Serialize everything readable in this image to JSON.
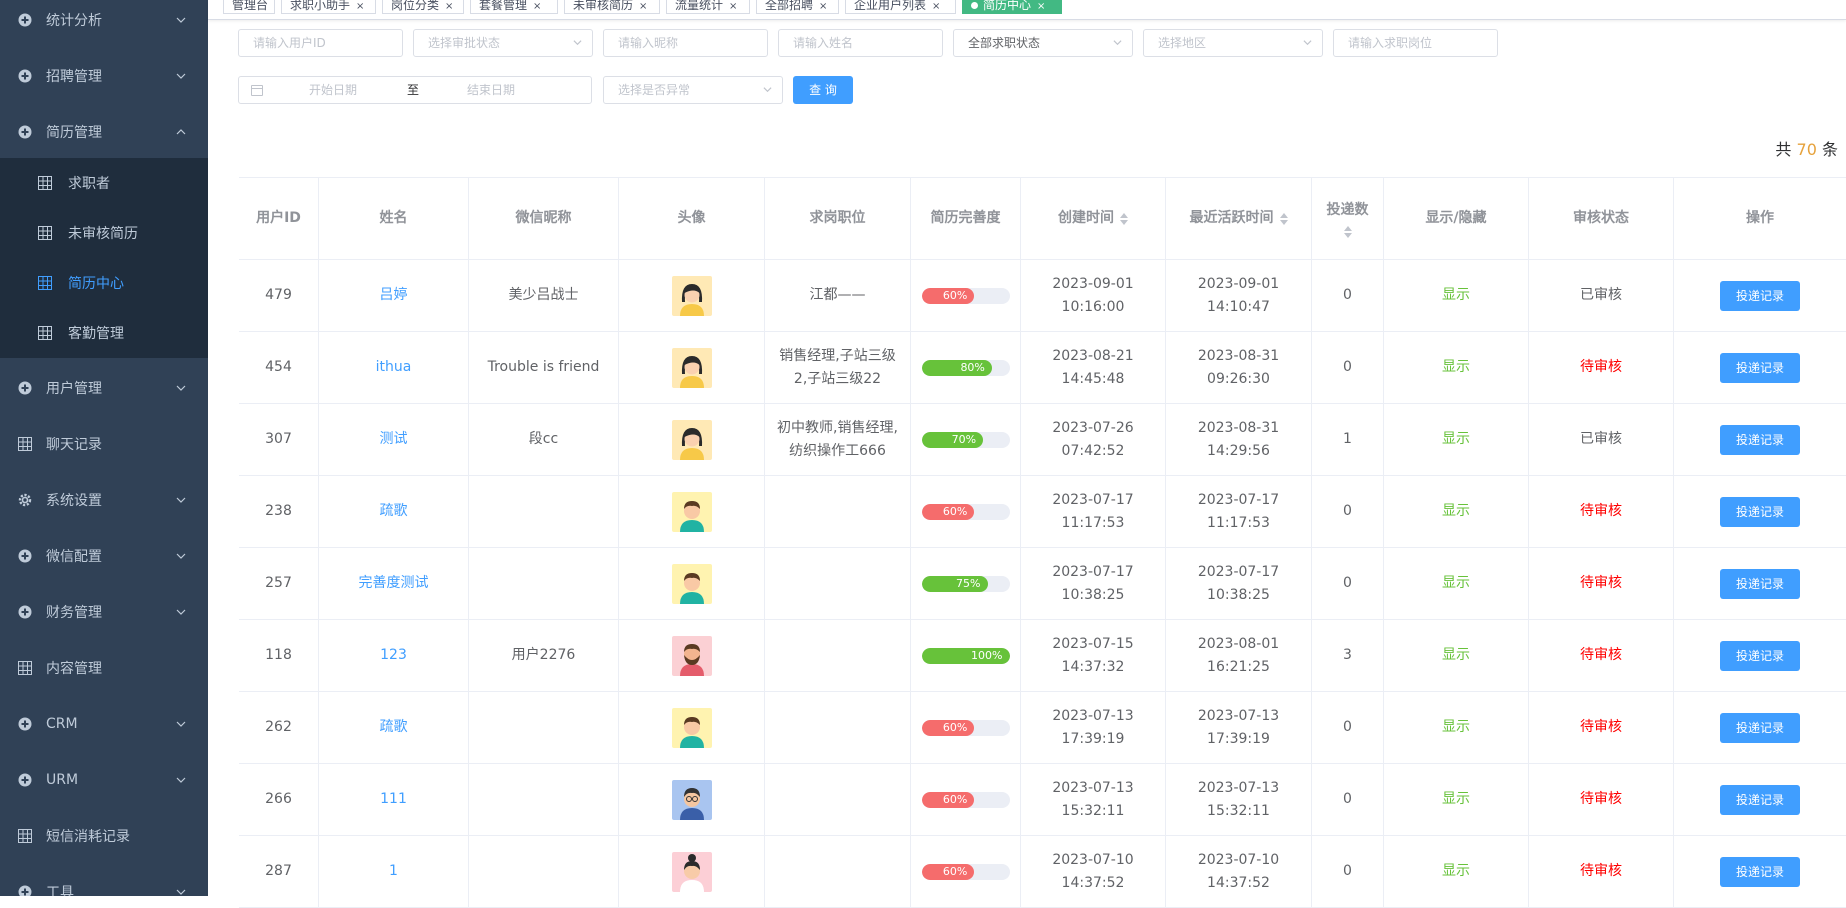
{
  "sidebar": {
    "items": [
      {
        "label": "统计分析",
        "icon": "plus-circle-icon",
        "chevron": "down"
      },
      {
        "label": "招聘管理",
        "icon": "plus-circle-icon",
        "chevron": "down"
      },
      {
        "label": "简历管理",
        "icon": "plus-circle-icon",
        "chevron": "up"
      },
      {
        "label": "用户管理",
        "icon": "plus-circle-icon",
        "chevron": "down"
      },
      {
        "label": "聊天记录",
        "icon": "grid-icon",
        "chevron": ""
      },
      {
        "label": "系统设置",
        "icon": "gear-icon",
        "chevron": "down"
      },
      {
        "label": "微信配置",
        "icon": "plus-circle-icon",
        "chevron": "down"
      },
      {
        "label": "财务管理",
        "icon": "plus-circle-icon",
        "chevron": "down"
      },
      {
        "label": "内容管理",
        "icon": "grid-icon",
        "chevron": ""
      },
      {
        "label": "CRM",
        "icon": "plus-circle-icon",
        "chevron": "down"
      },
      {
        "label": "URM",
        "icon": "plus-circle-icon",
        "chevron": "down"
      },
      {
        "label": "短信消耗记录",
        "icon": "grid-icon",
        "chevron": ""
      },
      {
        "label": "工具",
        "icon": "plus-circle-icon",
        "chevron": "down"
      }
    ],
    "subitems": [
      {
        "label": "求职者",
        "active": false
      },
      {
        "label": "未审核简历",
        "active": false
      },
      {
        "label": "简历中心",
        "active": true
      },
      {
        "label": "客勤管理",
        "active": false
      }
    ]
  },
  "tags": [
    {
      "label": "管理台",
      "close": ""
    },
    {
      "label": "求职小助手",
      "close": "×"
    },
    {
      "label": "岗位分类",
      "close": "×"
    },
    {
      "label": "套餐管理",
      "close": "×"
    },
    {
      "label": "未审核简历",
      "close": "×"
    },
    {
      "label": "流量统计",
      "close": "×"
    },
    {
      "label": "全部招聘",
      "close": "×"
    },
    {
      "label": "企业用户列表",
      "close": "×"
    },
    {
      "label": "简历中心",
      "close": "×",
      "active": true
    }
  ],
  "filters": {
    "user_id": "请输入用户ID",
    "audit_status": "选择审批状态",
    "nickname": "请输入昵称",
    "name": "请输入姓名",
    "job_status": "全部求职状态",
    "region": "选择地区",
    "job_title": "请输入求职岗位",
    "start_date": "开始日期",
    "date_sep": "至",
    "end_date": "结束日期",
    "abnormal": "选择是否异常",
    "query_button": "查 询"
  },
  "total": {
    "prefix": "共",
    "count": "70",
    "suffix": "条"
  },
  "table": {
    "headers": [
      "用户ID",
      "姓名",
      "微信昵称",
      "头像",
      "求岗职位",
      "简历完善度",
      "创建时间",
      "最近活跃时间",
      "投递数",
      "显示/隐藏",
      "审核状态",
      "操作"
    ],
    "rows": [
      {
        "id": "479",
        "name": "吕婷",
        "nickname": "美少吕战士",
        "avatar": "female",
        "job": "江都——",
        "progress": 60,
        "progress_label": "60%",
        "created_date": "2023-09-01",
        "created_time": "10:16:00",
        "active_date": "2023-09-01",
        "active_time": "14:10:47",
        "deliveries": "0",
        "visibility": "显示",
        "audit": "已审核",
        "audit_ok": true,
        "action": "投递记录"
      },
      {
        "id": "454",
        "name": "ithua",
        "nickname": "Trouble is friend",
        "avatar": "female",
        "job": "销售经理,子站三级2,子站三级22",
        "progress": 80,
        "progress_label": "80%",
        "created_date": "2023-08-21",
        "created_time": "14:45:48",
        "active_date": "2023-08-31",
        "active_time": "09:26:30",
        "deliveries": "0",
        "visibility": "显示",
        "audit": "待审核",
        "audit_ok": false,
        "action": "投递记录"
      },
      {
        "id": "307",
        "name": "测试",
        "nickname": "段cc",
        "avatar": "female",
        "job": "初中教师,销售经理,纺织操作工666",
        "progress": 70,
        "progress_label": "70%",
        "created_date": "2023-07-26",
        "created_time": "07:42:52",
        "active_date": "2023-08-31",
        "active_time": "14:29:56",
        "deliveries": "1",
        "visibility": "显示",
        "audit": "已审核",
        "audit_ok": true,
        "action": "投递记录"
      },
      {
        "id": "238",
        "name": "疏歌",
        "nickname": "",
        "avatar": "male",
        "job": "",
        "progress": 60,
        "progress_label": "60%",
        "created_date": "2023-07-17",
        "created_time": "11:17:53",
        "active_date": "2023-07-17",
        "active_time": "11:17:53",
        "deliveries": "0",
        "visibility": "显示",
        "audit": "待审核",
        "audit_ok": false,
        "action": "投递记录"
      },
      {
        "id": "257",
        "name": "完善度测试",
        "nickname": "",
        "avatar": "male",
        "job": "",
        "progress": 75,
        "progress_label": "75%",
        "created_date": "2023-07-17",
        "created_time": "10:38:25",
        "active_date": "2023-07-17",
        "active_time": "10:38:25",
        "deliveries": "0",
        "visibility": "显示",
        "audit": "待审核",
        "audit_ok": false,
        "action": "投递记录"
      },
      {
        "id": "118",
        "name": "123",
        "nickname": "用户2276",
        "avatar": "beard",
        "job": "",
        "progress": 100,
        "progress_label": "100%",
        "created_date": "2023-07-15",
        "created_time": "14:37:32",
        "active_date": "2023-08-01",
        "active_time": "16:21:25",
        "deliveries": "3",
        "visibility": "显示",
        "audit": "待审核",
        "audit_ok": false,
        "action": "投递记录"
      },
      {
        "id": "262",
        "name": "疏歌",
        "nickname": "",
        "avatar": "male",
        "job": "",
        "progress": 60,
        "progress_label": "60%",
        "created_date": "2023-07-13",
        "created_time": "17:39:19",
        "active_date": "2023-07-13",
        "active_time": "17:39:19",
        "deliveries": "0",
        "visibility": "显示",
        "audit": "待审核",
        "audit_ok": false,
        "action": "投递记录"
      },
      {
        "id": "266",
        "name": "111",
        "nickname": "",
        "avatar": "glasses",
        "job": "",
        "progress": 60,
        "progress_label": "60%",
        "created_date": "2023-07-13",
        "created_time": "15:32:11",
        "active_date": "2023-07-13",
        "active_time": "15:32:11",
        "deliveries": "0",
        "visibility": "显示",
        "audit": "待审核",
        "audit_ok": false,
        "action": "投递记录"
      },
      {
        "id": "287",
        "name": "1",
        "nickname": "",
        "avatar": "bun",
        "job": "",
        "progress": 60,
        "progress_label": "60%",
        "created_date": "2023-07-10",
        "created_time": "14:37:52",
        "active_date": "2023-07-10",
        "active_time": "14:37:52",
        "deliveries": "0",
        "visibility": "显示",
        "audit": "待审核",
        "audit_ok": false,
        "action": "投递记录"
      }
    ]
  },
  "colors": {
    "sidebar_bg": "#304156",
    "submenu_bg": "#1f2d3d",
    "primary": "#409eff",
    "success": "#67c23a",
    "danger": "#f56c6c",
    "progress_green": "#67c23a",
    "progress_red": "#f56c6c",
    "tag_active": "#42b983"
  }
}
